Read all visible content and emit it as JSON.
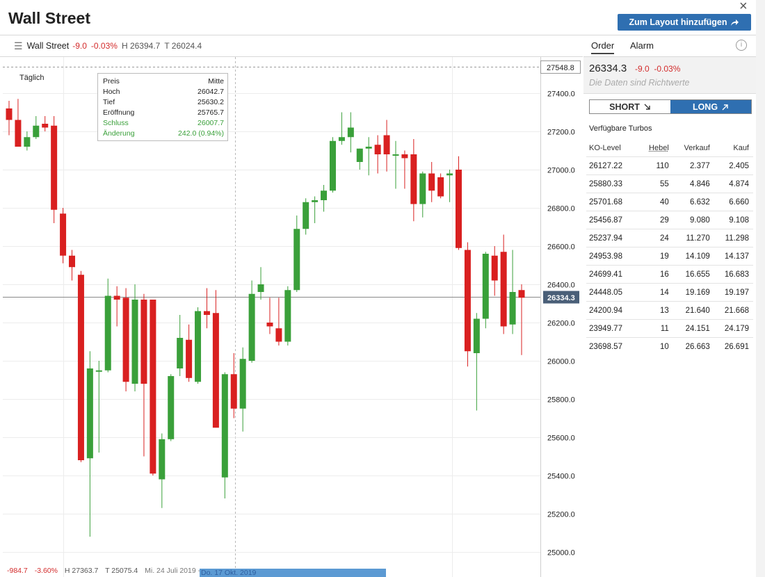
{
  "header": {
    "title": "Wall Street",
    "add_button": "Zum Layout hinzufügen",
    "close_symbol": "×"
  },
  "subbar": {
    "symbol": "Wall Street",
    "change": "-9.0",
    "change_pct": "-0.03%",
    "high": "H 26394.7",
    "low": "T 26024.4"
  },
  "chart": {
    "period": "Täglich",
    "tooltip": {
      "col1": "Preis",
      "col2": "Mitte",
      "rows": [
        {
          "label": "Hoch",
          "value": "26042.7",
          "green": false
        },
        {
          "label": "Tief",
          "value": "25630.2",
          "green": false
        },
        {
          "label": "Eröffnung",
          "value": "25765.7",
          "green": false
        },
        {
          "label": "Schluss",
          "value": "26007.7",
          "green": true
        },
        {
          "label": "Änderung",
          "value": "242.0 (0.94%)",
          "green": true
        }
      ]
    },
    "top_price": "27548.8",
    "current_price": "26334.3",
    "colors": {
      "up": "#3aa03a",
      "down": "#d92020",
      "price_label": "#4a5f78"
    }
  },
  "chart_data": {
    "type": "candlestick",
    "ylim": [
      24950,
      27600
    ],
    "yticks": [
      25000,
      25200,
      25400,
      25600,
      25800,
      26000,
      26200,
      26400,
      26600,
      26800,
      27000,
      27200,
      27400
    ],
    "reference_lines": [
      27548.8,
      26334.3
    ],
    "candles": [
      {
        "o": 27320,
        "h": 27360,
        "l": 27180,
        "c": 27260
      },
      {
        "o": 27260,
        "h": 27370,
        "l": 27120,
        "c": 27120
      },
      {
        "o": 27120,
        "h": 27200,
        "l": 27100,
        "c": 27170
      },
      {
        "o": 27170,
        "h": 27280,
        "l": 27160,
        "c": 27230
      },
      {
        "o": 27240,
        "h": 27280,
        "l": 27200,
        "c": 27220
      },
      {
        "o": 27230,
        "h": 27280,
        "l": 26720,
        "c": 26790
      },
      {
        "o": 26770,
        "h": 26800,
        "l": 26510,
        "c": 26550
      },
      {
        "o": 26550,
        "h": 26580,
        "l": 26420,
        "c": 26490
      },
      {
        "o": 26450,
        "h": 26470,
        "l": 25470,
        "c": 25480
      },
      {
        "o": 25490,
        "h": 26050,
        "l": 25080,
        "c": 25960
      },
      {
        "o": 25950,
        "h": 26000,
        "l": 25520,
        "c": 25950
      },
      {
        "o": 25950,
        "h": 26430,
        "l": 25940,
        "c": 26340
      },
      {
        "o": 26340,
        "h": 26390,
        "l": 26180,
        "c": 26320
      },
      {
        "o": 26330,
        "h": 26380,
        "l": 25840,
        "c": 25890
      },
      {
        "o": 25880,
        "h": 26400,
        "l": 25840,
        "c": 26320
      },
      {
        "o": 26320,
        "h": 26350,
        "l": 25500,
        "c": 25880
      },
      {
        "o": 26320,
        "h": 26320,
        "l": 25400,
        "c": 25410
      },
      {
        "o": 25380,
        "h": 25620,
        "l": 25230,
        "c": 25590
      },
      {
        "o": 25590,
        "h": 25930,
        "l": 25580,
        "c": 25920
      },
      {
        "o": 25960,
        "h": 26240,
        "l": 25920,
        "c": 26120
      },
      {
        "o": 26110,
        "h": 26190,
        "l": 25890,
        "c": 25910
      },
      {
        "o": 25890,
        "h": 26280,
        "l": 25880,
        "c": 26260
      },
      {
        "o": 26260,
        "h": 26380,
        "l": 26170,
        "c": 26240
      },
      {
        "o": 26250,
        "h": 26370,
        "l": 25850,
        "c": 25650
      },
      {
        "o": 25390,
        "h": 25940,
        "l": 25280,
        "c": 25930
      },
      {
        "o": 25930,
        "h": 26040,
        "l": 25700,
        "c": 25750
      },
      {
        "o": 25750,
        "h": 26070,
        "l": 25630,
        "c": 26010
      },
      {
        "o": 26000,
        "h": 26420,
        "l": 25990,
        "c": 26350
      },
      {
        "o": 26360,
        "h": 26490,
        "l": 26320,
        "c": 26400
      },
      {
        "o": 26200,
        "h": 26330,
        "l": 26140,
        "c": 26180
      },
      {
        "o": 26170,
        "h": 26330,
        "l": 26080,
        "c": 26100
      },
      {
        "o": 26100,
        "h": 26390,
        "l": 26080,
        "c": 26370
      },
      {
        "o": 26370,
        "h": 26760,
        "l": 26360,
        "c": 26690
      },
      {
        "o": 26690,
        "h": 26850,
        "l": 26660,
        "c": 26830
      },
      {
        "o": 26830,
        "h": 26860,
        "l": 26720,
        "c": 26840
      },
      {
        "o": 26840,
        "h": 26920,
        "l": 26780,
        "c": 26890
      },
      {
        "o": 26890,
        "h": 27170,
        "l": 26880,
        "c": 27150
      },
      {
        "o": 27150,
        "h": 27300,
        "l": 27130,
        "c": 27170
      },
      {
        "o": 27170,
        "h": 27300,
        "l": 27090,
        "c": 27220
      },
      {
        "o": 27040,
        "h": 27110,
        "l": 27000,
        "c": 27110
      },
      {
        "o": 27110,
        "h": 27170,
        "l": 26970,
        "c": 27120
      },
      {
        "o": 27130,
        "h": 27180,
        "l": 26980,
        "c": 27080
      },
      {
        "o": 27180,
        "h": 27260,
        "l": 26990,
        "c": 27080
      },
      {
        "o": 27080,
        "h": 27150,
        "l": 26900,
        "c": 27080
      },
      {
        "o": 27080,
        "h": 27100,
        "l": 26900,
        "c": 27060
      },
      {
        "o": 27080,
        "h": 27160,
        "l": 26730,
        "c": 26820
      },
      {
        "o": 26820,
        "h": 26990,
        "l": 26750,
        "c": 26980
      },
      {
        "o": 26980,
        "h": 27040,
        "l": 26830,
        "c": 26890
      },
      {
        "o": 26960,
        "h": 26980,
        "l": 26850,
        "c": 26860
      },
      {
        "o": 26970,
        "h": 27000,
        "l": 26830,
        "c": 26980
      },
      {
        "o": 27000,
        "h": 27070,
        "l": 26580,
        "c": 26590
      },
      {
        "o": 26580,
        "h": 26620,
        "l": 25970,
        "c": 26050
      },
      {
        "o": 26040,
        "h": 26250,
        "l": 25740,
        "c": 26220
      },
      {
        "o": 26220,
        "h": 26570,
        "l": 26170,
        "c": 26560
      },
      {
        "o": 26550,
        "h": 26600,
        "l": 26340,
        "c": 26420
      },
      {
        "o": 26570,
        "h": 26660,
        "l": 26140,
        "c": 26180
      },
      {
        "o": 26190,
        "h": 26580,
        "l": 26140,
        "c": 26360
      },
      {
        "o": 26370,
        "h": 26400,
        "l": 26030,
        "c": 26330
      }
    ]
  },
  "right_panel": {
    "tabs": [
      "Order",
      "Alarm"
    ],
    "price": "26334.3",
    "change": "-9.0",
    "change_pct": "-0.03%",
    "note": "Die Daten sind Richtwerte",
    "short_label": "SHORT",
    "long_label": "LONG",
    "turbos_title": "Verfügbare Turbos",
    "columns": [
      "KO-Level",
      "Hebel",
      "Verkauf",
      "Kauf"
    ],
    "rows": [
      [
        "26127.22",
        "110",
        "2.377",
        "2.405"
      ],
      [
        "25880.33",
        "55",
        "4.846",
        "4.874"
      ],
      [
        "25701.68",
        "40",
        "6.632",
        "6.660"
      ],
      [
        "25456.87",
        "29",
        "9.080",
        "9.108"
      ],
      [
        "25237.94",
        "24",
        "11.270",
        "11.298"
      ],
      [
        "24953.98",
        "19",
        "14.109",
        "14.137"
      ],
      [
        "24699.41",
        "16",
        "16.655",
        "16.683"
      ],
      [
        "24448.05",
        "14",
        "19.169",
        "19.197"
      ],
      [
        "24200.94",
        "13",
        "21.640",
        "21.668"
      ],
      [
        "23949.77",
        "11",
        "24.151",
        "24.179"
      ],
      [
        "23698.57",
        "10",
        "26.663",
        "26.691"
      ]
    ]
  },
  "statusbar": {
    "change": "-984.7",
    "change_pct": "-3.60%",
    "high": "H 27363.7",
    "low": "T 25075.4",
    "date_from": "Mi. 24 Juli 2019 -",
    "date_to": "Do. 17 Okt. 2019"
  }
}
